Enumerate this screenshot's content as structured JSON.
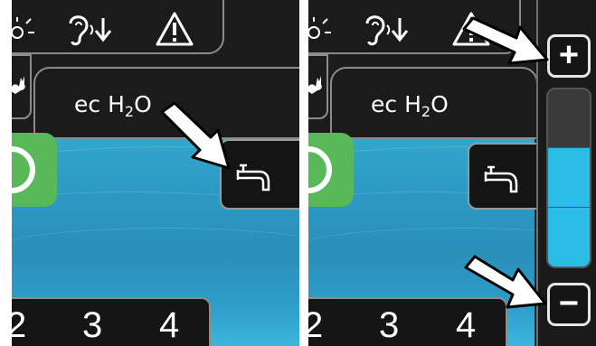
{
  "panels": [
    {
      "logo": {
        "main": "ec H",
        "sub": "2",
        "end": "O"
      },
      "numbers": [
        "2",
        "3",
        "4"
      ],
      "icons": [
        "sun-icon",
        "ear-down-icon",
        "warning-icon",
        "rabbit-icon",
        "power-icon",
        "faucet-icon",
        "arrow-icon"
      ]
    },
    {
      "logo": {
        "main": "ec H",
        "sub": "2",
        "end": "O"
      },
      "numbers": [
        "2",
        "3",
        "4"
      ],
      "controls": {
        "plus": "+",
        "minus": "−"
      },
      "level": {
        "segments": 3,
        "filled": 2,
        "fill_color": "#2bbce8",
        "empty_color": "#3a3a3a"
      }
    }
  ],
  "colors": {
    "green": "#58b85a",
    "water": "#2c9ac4",
    "background": "#1b1b1b"
  }
}
